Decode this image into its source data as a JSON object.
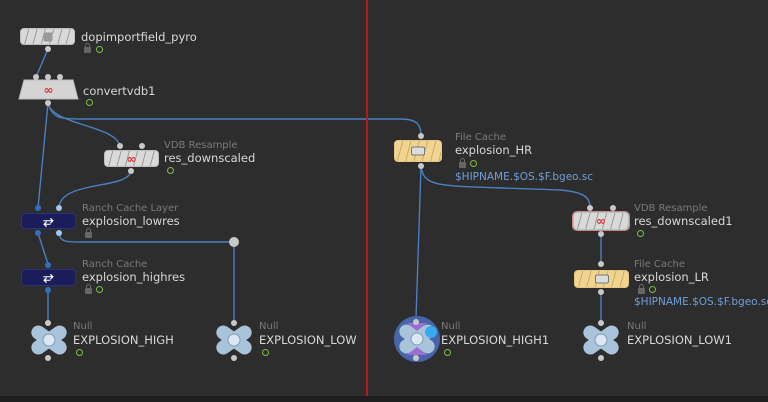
{
  "colors": {
    "wire": "#4a7fc0",
    "divider": "#b51a1a",
    "background": "#2d2d2d",
    "flag": "#7cc03c",
    "path": "#6f9fd8"
  },
  "nodes": {
    "dopimport": {
      "name": "dopimportfield_pyro",
      "icon": "dop-import-icon"
    },
    "convertvdb": {
      "name": "convertvdb1",
      "icon": "vdb-icon"
    },
    "res_downscaled": {
      "type": "VDB Resample",
      "name": "res_downscaled",
      "icon": "vdb-icon"
    },
    "lowres": {
      "type": "Ranch Cache Layer",
      "name": "explosion_lowres",
      "icon": "ranch-icon",
      "glyph": "⥂"
    },
    "highres": {
      "type": "Ranch Cache",
      "name": "explosion_highres",
      "icon": "ranch-icon",
      "glyph": "⥂"
    },
    "null_high": {
      "type": "Null",
      "name": "EXPLOSION_HIGH"
    },
    "null_low": {
      "type": "Null",
      "name": "EXPLOSION_LOW"
    },
    "file_hr": {
      "type": "File Cache",
      "name": "explosion_HR",
      "path": "$HIPNAME.$OS.$F.bgeo.sc"
    },
    "res_downscaled1": {
      "type": "VDB Resample",
      "name": "res_downscaled1"
    },
    "file_lr": {
      "type": "File Cache",
      "name": "explosion_LR",
      "path": "$HIPNAME.$OS.$F.bgeo.sc"
    },
    "null_high1": {
      "type": "Null",
      "name": "EXPLOSION_HIGH1"
    },
    "null_low1": {
      "type": "Null",
      "name": "EXPLOSION_LOW1"
    }
  }
}
